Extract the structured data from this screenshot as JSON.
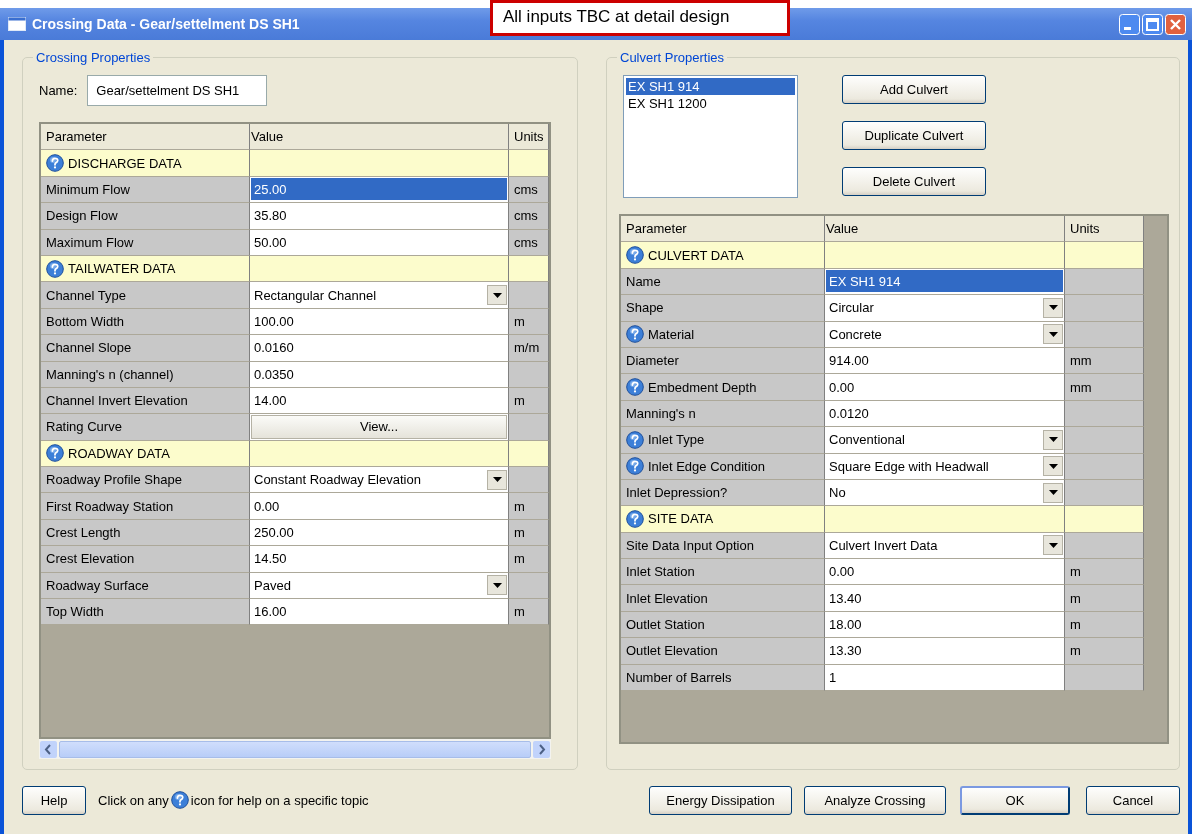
{
  "window": {
    "title": "Crossing Data - Gear/settelment DS SH1"
  },
  "note": "All inputs TBC at detail design",
  "crossing": {
    "legend": "Crossing Properties",
    "name_label": "Name:",
    "name_value": "Gear/settelment DS SH1",
    "table": {
      "columns": [
        "Parameter",
        "Value",
        "Units"
      ],
      "rows": [
        {
          "kind": "section",
          "label": "DISCHARGE DATA"
        },
        {
          "kind": "text",
          "parameter": "Minimum Flow",
          "value": "25.00",
          "units": "cms",
          "selected": true,
          "help": false
        },
        {
          "kind": "text",
          "parameter": "Design Flow",
          "value": "35.80",
          "units": "cms",
          "selected": false,
          "help": false
        },
        {
          "kind": "text",
          "parameter": "Maximum Flow",
          "value": "50.00",
          "units": "cms",
          "selected": false,
          "help": false
        },
        {
          "kind": "section",
          "label": "TAILWATER DATA"
        },
        {
          "kind": "dropdown",
          "parameter": "Channel Type",
          "value": "Rectangular Channel",
          "selected": false,
          "help": false
        },
        {
          "kind": "text",
          "parameter": "Bottom Width",
          "value": "100.00",
          "units": "m",
          "selected": false,
          "help": false
        },
        {
          "kind": "text",
          "parameter": "Channel Slope",
          "value": "0.0160",
          "units": "m/m",
          "selected": false,
          "help": false
        },
        {
          "kind": "text",
          "parameter": "Manning's n (channel)",
          "value": "0.0350",
          "selected": false,
          "help": false
        },
        {
          "kind": "text",
          "parameter": "Channel Invert Elevation",
          "value": "14.00",
          "units": "m",
          "selected": false,
          "help": false
        },
        {
          "kind": "button",
          "parameter": "Rating Curve",
          "value": "View...",
          "selected": false,
          "help": false
        },
        {
          "kind": "section",
          "label": "ROADWAY DATA"
        },
        {
          "kind": "dropdown",
          "parameter": "Roadway Profile Shape",
          "value": "Constant Roadway Elevation",
          "selected": false,
          "help": false
        },
        {
          "kind": "text",
          "parameter": "First Roadway Station",
          "value": "0.00",
          "units": "m",
          "selected": false,
          "help": false
        },
        {
          "kind": "text",
          "parameter": "Crest Length",
          "value": "250.00",
          "units": "m",
          "selected": false,
          "help": false
        },
        {
          "kind": "text",
          "parameter": "Crest Elevation",
          "value": "14.50",
          "units": "m",
          "selected": false,
          "help": false
        },
        {
          "kind": "dropdown",
          "parameter": "Roadway Surface",
          "value": "Paved",
          "selected": false,
          "help": false
        },
        {
          "kind": "text",
          "parameter": "Top Width",
          "value": "16.00",
          "units": "m",
          "selected": false,
          "help": false
        }
      ]
    }
  },
  "culvert": {
    "legend": "Culvert Properties",
    "list": [
      {
        "label": "EX SH1 914",
        "selected": true
      },
      {
        "label": "EX SH1 1200",
        "selected": false
      }
    ],
    "buttons": [
      "Add Culvert",
      "Duplicate Culvert",
      "Delete Culvert"
    ],
    "table": {
      "columns": [
        "Parameter",
        "Value",
        "Units"
      ],
      "rows": [
        {
          "kind": "section",
          "label": "CULVERT DATA"
        },
        {
          "kind": "text",
          "parameter": "Name",
          "value": "EX SH1 914",
          "selected": true,
          "help": false
        },
        {
          "kind": "dropdown",
          "parameter": "Shape",
          "value": "Circular",
          "selected": false,
          "help": false
        },
        {
          "kind": "dropdown",
          "parameter": "Material",
          "value": "Concrete",
          "selected": false,
          "help": true
        },
        {
          "kind": "text",
          "parameter": "Diameter",
          "value": "914.00",
          "units": "mm",
          "selected": false,
          "help": false
        },
        {
          "kind": "text",
          "parameter": "Embedment Depth",
          "value": "0.00",
          "units": "mm",
          "selected": false,
          "help": true
        },
        {
          "kind": "text",
          "parameter": "Manning's n",
          "value": "0.0120",
          "selected": false,
          "help": false
        },
        {
          "kind": "dropdown",
          "parameter": "Inlet Type",
          "value": "Conventional",
          "selected": false,
          "help": true
        },
        {
          "kind": "dropdown",
          "parameter": "Inlet Edge Condition",
          "value": "Square Edge with Headwall",
          "selected": false,
          "help": true
        },
        {
          "kind": "dropdown",
          "parameter": "Inlet Depression?",
          "value": "No",
          "selected": false,
          "help": false
        },
        {
          "kind": "section",
          "label": "SITE DATA"
        },
        {
          "kind": "dropdown",
          "parameter": "Site Data Input Option",
          "value": "Culvert Invert Data",
          "selected": false,
          "help": false
        },
        {
          "kind": "text",
          "parameter": "Inlet Station",
          "value": "0.00",
          "units": "m",
          "selected": false,
          "help": false
        },
        {
          "kind": "text",
          "parameter": "Inlet Elevation",
          "value": "13.40",
          "units": "m",
          "selected": false,
          "help": false
        },
        {
          "kind": "text",
          "parameter": "Outlet Station",
          "value": "18.00",
          "units": "m",
          "selected": false,
          "help": false
        },
        {
          "kind": "text",
          "parameter": "Outlet Elevation",
          "value": "13.30",
          "units": "m",
          "selected": false,
          "help": false
        },
        {
          "kind": "text",
          "parameter": "Number of Barrels",
          "value": "1",
          "selected": false,
          "help": false
        }
      ]
    }
  },
  "footer": {
    "help_button": "Help",
    "hint_before": "Click on any",
    "hint_after": "icon for help on a specific topic",
    "buttons": [
      "Energy Dissipation",
      "Analyze Crossing",
      "OK",
      "Cancel"
    ]
  }
}
